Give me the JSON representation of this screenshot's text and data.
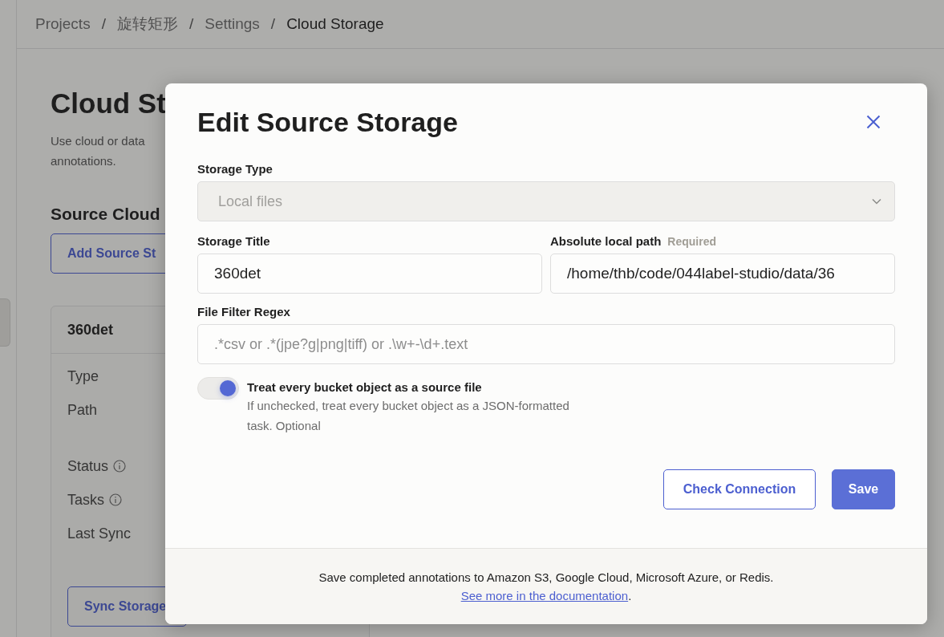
{
  "breadcrumb": [
    {
      "label": "Projects",
      "current": false
    },
    {
      "separator": "/",
      "label": "旋转矩形",
      "current": false
    },
    {
      "separator": "/",
      "label": "Settings",
      "current": false
    },
    {
      "separator": "/",
      "label": "Cloud Storage",
      "current": true
    }
  ],
  "page": {
    "title": "Cloud St",
    "description": [
      "Use cloud or data",
      "annotations."
    ],
    "section_title": "Source Cloud",
    "add_button": "Add Source St",
    "storage_card": {
      "name": "360det",
      "fields": [
        {
          "label": "Type",
          "info": false
        },
        {
          "label": "Path",
          "info": false
        },
        {
          "label": "Status",
          "info": true
        },
        {
          "label": "Tasks",
          "info": true
        },
        {
          "label": "Last Sync",
          "info": false
        }
      ],
      "sync_button": "Sync Storage"
    }
  },
  "dialog": {
    "title": "Edit Source Storage",
    "storage_type": {
      "label": "Storage Type",
      "value": "Local files",
      "disabled": true
    },
    "storage_title": {
      "label": "Storage Title",
      "value": "360det"
    },
    "local_path": {
      "label": "Absolute local path",
      "hint": "Required",
      "value": "/home/thb/code/044label-studio/data/36"
    },
    "file_filter": {
      "label": "File Filter Regex",
      "placeholder": ".*csv or .*(jpe?g|png|tiff) or .\\w+-\\d+.text"
    },
    "toggle": {
      "label": "Treat every bucket object as a source file",
      "description": "If unchecked, treat every bucket object as a JSON-formatted task. Optional",
      "on": true
    },
    "buttons": [
      {
        "label": "Check Connection",
        "kind": "outline"
      },
      {
        "label": "Save",
        "kind": "primary"
      }
    ],
    "footer": {
      "text": "Save completed annotations to Amazon S3, Google Cloud, Microsoft Azure, or Redis.",
      "link": "See more in the documentation",
      "after": "."
    }
  }
}
